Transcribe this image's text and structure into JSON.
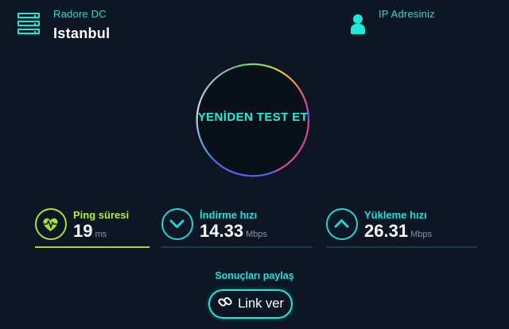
{
  "server": {
    "provider": "Radore DC",
    "city": "Istanbul",
    "icon": "server-icon"
  },
  "ip": {
    "label": "IP Adresiniz",
    "icon": "user-icon"
  },
  "gauge": {
    "action_label": "YENİDEN TEST ET"
  },
  "stats": {
    "ping": {
      "label": "Ping süresi",
      "value": "19",
      "unit": "ms",
      "icon": "heartbeat-icon",
      "color": "#a8e330"
    },
    "download": {
      "label": "İndirme hızı",
      "value": "14.33",
      "unit": "Mbps",
      "icon": "chevron-down-icon",
      "color": "#20d6d6"
    },
    "upload": {
      "label": "Yükleme hızı",
      "value": "26.31",
      "unit": "Mbps",
      "icon": "chevron-up-icon",
      "color": "#20d6d6"
    }
  },
  "share": {
    "label": "Sonuçları paylaş",
    "button_label": "Link ver",
    "icon": "link-icon"
  },
  "colors": {
    "background": "#0c1624",
    "accent": "#1de9d6",
    "ping_accent": "#a8e330"
  }
}
